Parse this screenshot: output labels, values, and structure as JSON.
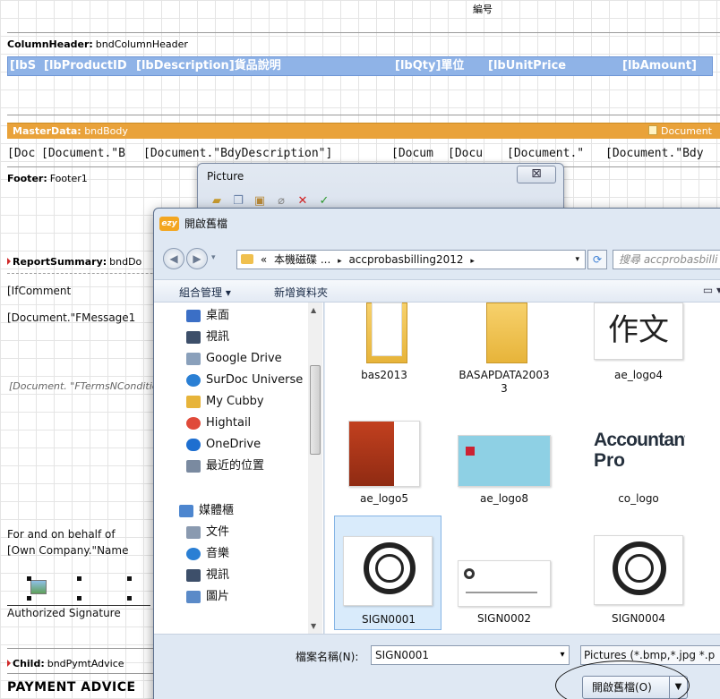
{
  "designer": {
    "top_caption": "編号",
    "column_header": {
      "label_bold": "ColumnHeader:",
      "label_name": "bndColumnHeader",
      "cells": [
        "[lbS",
        "[lbProductID",
        "[lbDescription]貨品說明",
        "[lbQty]單位",
        "[lbUnitPrice",
        "[lbAmount]"
      ]
    },
    "master_data": {
      "label_bold": "MasterData:",
      "label_name": "bndBody",
      "right_label": "Document",
      "fields": [
        "[Doc",
        "[Document.\"B",
        "[Document.\"BdyDescription\"]",
        "[Docum",
        "[Docu",
        "[Document.\"",
        "[Document.\"Bdy"
      ]
    },
    "footer": {
      "label_bold": "Footer:",
      "label_name": "Footer1"
    },
    "report_summary": {
      "label_bold": "ReportSummary:",
      "label_name": "bndDo",
      "fields": [
        "[IfComment",
        "[Document.\"FMessage1",
        "[Document. \"FTermsNConditio"
      ]
    },
    "signature": {
      "line1": "For and on behalf of",
      "line2": "[Own Company.\"Name",
      "caption": "Authorized Signature"
    },
    "child": {
      "label_bold": "Child:",
      "label_name": "bndPymtAdvice",
      "payment_advice": "PAYMENT ADVICE"
    }
  },
  "picture_dialog": {
    "title": "Picture",
    "close_glyph": "⊠",
    "toolbar_icons": [
      "open-icon",
      "copy-icon",
      "paste-icon",
      "clear-icon",
      "cancel-icon",
      "ok-icon"
    ]
  },
  "open_dialog": {
    "title": "開啟舊檔",
    "app_badge": "ezy",
    "address": {
      "prefix": "«",
      "segments": [
        "本機磁碟 ...",
        "accprobasbilling2012"
      ]
    },
    "search_placeholder": "搜尋 accprobasbilli",
    "toolbar": {
      "organize": "組合管理 ▾",
      "new_folder": "新增資料夾"
    },
    "nav_items": [
      {
        "label": "桌面",
        "icon": "desktop-icon",
        "color": "#3b6fc6"
      },
      {
        "label": "視訊",
        "icon": "video-icon",
        "color": "#3d4f6a"
      },
      {
        "label": "Google Drive",
        "icon": "google-drive-icon",
        "color": "#8aa0bb"
      },
      {
        "label": "SurDoc Universe",
        "icon": "surdoc-icon",
        "color": "#2a7fd4"
      },
      {
        "label": "My Cubby",
        "icon": "cubby-icon",
        "color": "#e7b43a"
      },
      {
        "label": "Hightail",
        "icon": "hightail-icon",
        "color": "#e04a3a"
      },
      {
        "label": "OneDrive",
        "icon": "onedrive-icon",
        "color": "#1e6fd0"
      },
      {
        "label": "最近的位置",
        "icon": "recent-places-icon",
        "color": "#7a8aa0"
      }
    ],
    "libraries": [
      {
        "label": "媒體櫃",
        "icon": "libraries-icon",
        "color": "#4d86cf"
      },
      {
        "label": "文件",
        "icon": "documents-icon",
        "color": "#8a9ab0"
      },
      {
        "label": "音樂",
        "icon": "music-icon",
        "color": "#2a7fd4"
      },
      {
        "label": "視訊",
        "icon": "video-icon",
        "color": "#3d4f6a"
      },
      {
        "label": "圖片",
        "icon": "pictures-icon",
        "color": "#5a8ac8"
      }
    ],
    "files": [
      {
        "name": "bas2013",
        "kind": "folder"
      },
      {
        "name": "BASAPDATA2003",
        "kind": "folder"
      },
      {
        "name": "ae_logo4",
        "kind": "image-calligraphy"
      },
      {
        "name": "ae_logo5",
        "kind": "image-red"
      },
      {
        "name": "ae_logo8",
        "kind": "image-card"
      },
      {
        "name": "co_logo",
        "kind": "image-text"
      },
      {
        "name": "SIGN0001",
        "kind": "image-stamp",
        "selected": true
      },
      {
        "name": "SIGN0002",
        "kind": "image-card2"
      },
      {
        "name": "SIGN0004",
        "kind": "image-stamp"
      }
    ],
    "co_logo_text": [
      "Accountant",
      "Pro"
    ],
    "calligraphy_glyph": "作文",
    "filename_label": "檔案名稱(N):",
    "filename_value": "SIGN0001",
    "filetype_value": "Pictures (*.bmp,*.jpg *.p",
    "open_button": "開啟舊檔(O)"
  }
}
